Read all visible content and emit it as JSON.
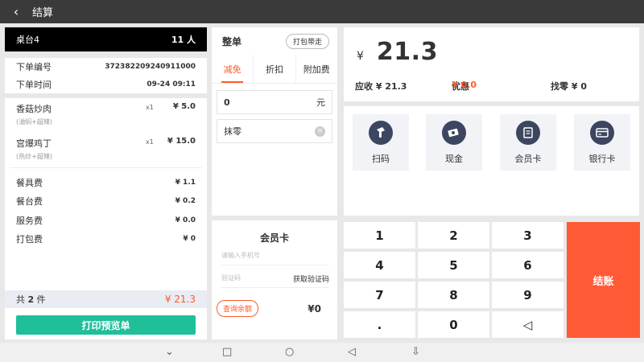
{
  "topbar": {
    "back_icon": "‹",
    "title": "结算"
  },
  "order": {
    "table_name": "桌台4",
    "people": "11 人",
    "order_no_label": "下单编号",
    "order_no": "372382209240911000",
    "order_time_label": "下单时间",
    "order_time": "09-24 09:11",
    "items": [
      {
        "name": "香菇炒肉",
        "note": "(油焖+超辣)",
        "qty": "x1",
        "price": "¥ 5.0"
      },
      {
        "name": "宫爆鸡丁",
        "note": "(热炒+超辣)",
        "qty": "x1",
        "price": "¥ 15.0"
      }
    ],
    "fees": [
      {
        "label": "餐具费",
        "value": "¥ 1.1"
      },
      {
        "label": "餐台费",
        "value": "¥ 0.2"
      },
      {
        "label": "服务费",
        "value": "¥ 0.0"
      },
      {
        "label": "打包费",
        "value": "¥ 0"
      }
    ],
    "total_prefix": "共",
    "total_count": "2",
    "total_suffix": "件",
    "total_amount": "¥ 21.3",
    "print_label": "打印预览单"
  },
  "discount": {
    "title": "整单",
    "takeaway_label": "打包带走",
    "tabs": [
      "减免",
      "折扣",
      "附加费"
    ],
    "amount_value": "0",
    "amount_unit": "元",
    "round_label": "抹零",
    "clear_icon": "×"
  },
  "member": {
    "title": "会员卡",
    "phone_placeholder": "请输入手机号",
    "code_placeholder": "验证码",
    "get_code_label": "获取验证码",
    "balance_button": "查询余额",
    "balance_value": "¥0"
  },
  "summary": {
    "currency": "¥",
    "amount": "21.3",
    "receivable": "应收 ¥ 21.3",
    "discount_label": "优惠",
    "discount_value": "¥ 0.0",
    "change": "找零 ¥ 0"
  },
  "payment": {
    "methods": [
      {
        "label": "扫码",
        "icon": "scanner-icon"
      },
      {
        "label": "现金",
        "icon": "cash-icon"
      },
      {
        "label": "会员卡",
        "icon": "member-card-icon"
      },
      {
        "label": "银行卡",
        "icon": "bank-card-icon"
      }
    ]
  },
  "keypad": {
    "keys": [
      "1",
      "2",
      "3",
      "4",
      "5",
      "6",
      "7",
      "8",
      "9",
      ".",
      "0",
      "◁"
    ],
    "checkout_label": "结账"
  },
  "navbar": {
    "icons": [
      "⌄",
      "□",
      "○",
      "◁",
      "⇩"
    ]
  },
  "colors": {
    "accent": "#ff5a2a",
    "print_button": "#1fbf9a",
    "checkout": "#ff5a35",
    "topbar": "#3a3a3a"
  }
}
